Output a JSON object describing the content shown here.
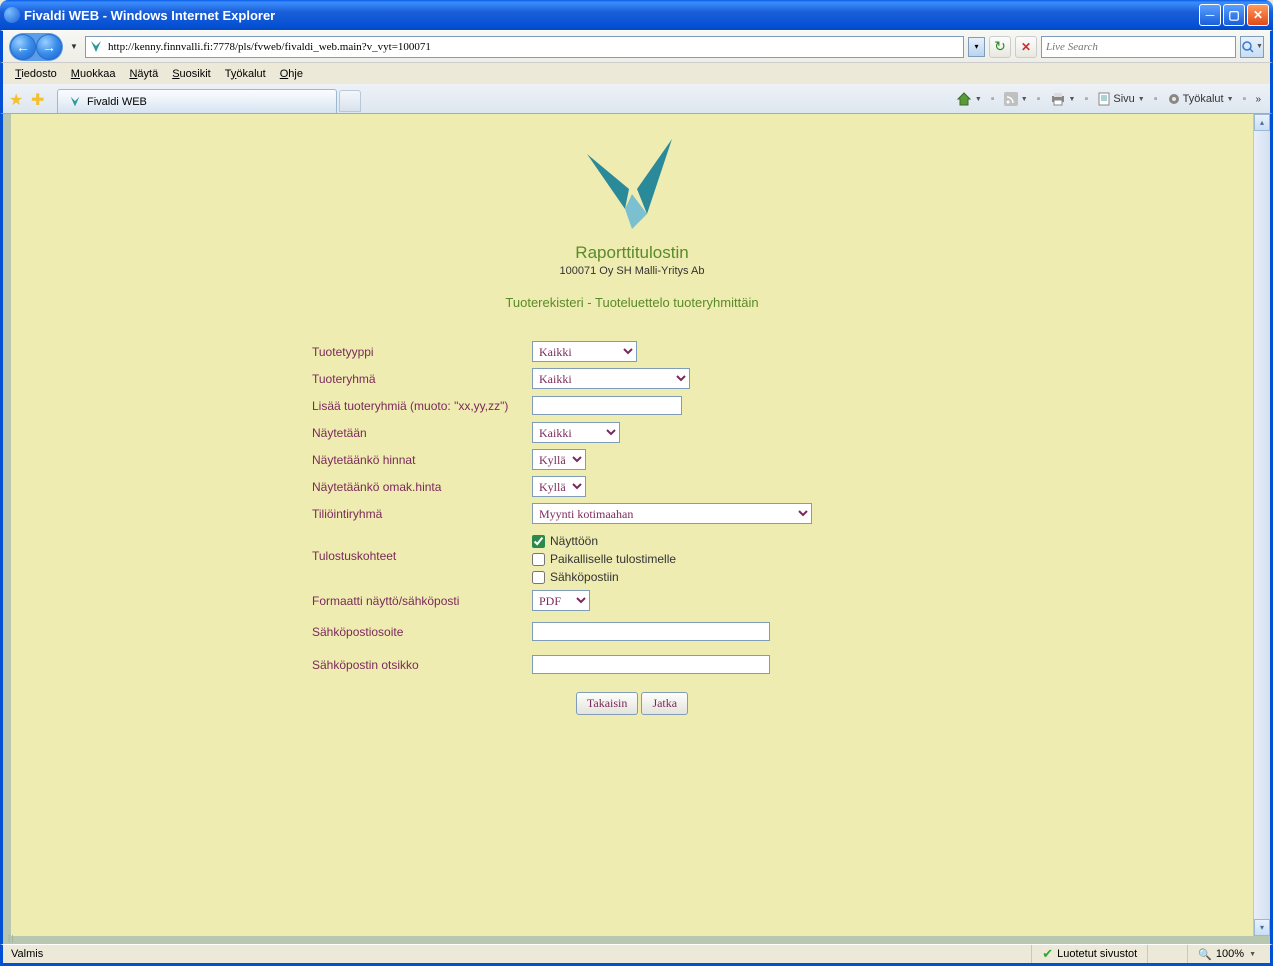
{
  "window": {
    "title": "Fivaldi WEB - Windows Internet Explorer"
  },
  "nav": {
    "url": "http://kenny.finnvalli.fi:7778/pls/fvweb/fivaldi_web.main?v_vyt=100071",
    "search_placeholder": "Live Search"
  },
  "menu": {
    "file": "Tiedosto",
    "edit": "Muokkaa",
    "view": "Näytä",
    "favorites": "Suosikit",
    "tools": "Työkalut",
    "help": "Ohje"
  },
  "tab": {
    "label": "Fivaldi WEB"
  },
  "toolbar": {
    "page": "Sivu",
    "tools": "Työkalut"
  },
  "page": {
    "app_title": "Raporttitulostin",
    "company": "100071 Oy SH Malli-Yritys Ab",
    "subtitle": "Tuoterekisteri - Tuoteluettelo tuoteryhmittäin"
  },
  "form": {
    "tuotetyyppi_label": "Tuotetyyppi",
    "tuotetyyppi_value": "Kaikki",
    "tuoteryhma_label": "Tuoteryhmä",
    "tuoteryhma_value": "Kaikki",
    "lisaa_label": "Lisää tuoteryhmiä (muoto: \"xx,yy,zz\")",
    "lisaa_value": "",
    "naytetaan_label": "Näytetään",
    "naytetaan_value": "Kaikki",
    "hinnat_label": "Näytetäänkö hinnat",
    "hinnat_value": "Kyllä",
    "omak_label": "Näytetäänkö omak.hinta",
    "omak_value": "Kyllä",
    "tilioryhma_label": "Tiliöintiryhmä",
    "tilioryhma_value": "Myynti kotimaahan",
    "tulostus_label": "Tulostuskohteet",
    "chk_nayttoon": "Näyttöön",
    "chk_paikallis": "Paikalliselle tulostimelle",
    "chk_sahko": "Sähköpostiin",
    "formaatti_label": "Formaatti näyttö/sähköposti",
    "formaatti_value": "PDF",
    "email_label": "Sähköpostiosoite",
    "email_value": "",
    "otsikko_label": "Sähköpostin otsikko",
    "otsikko_value": "",
    "back_btn": "Takaisin",
    "continue_btn": "Jatka"
  },
  "status": {
    "ready": "Valmis",
    "trusted": "Luotetut sivustot",
    "zoom": "100%"
  }
}
